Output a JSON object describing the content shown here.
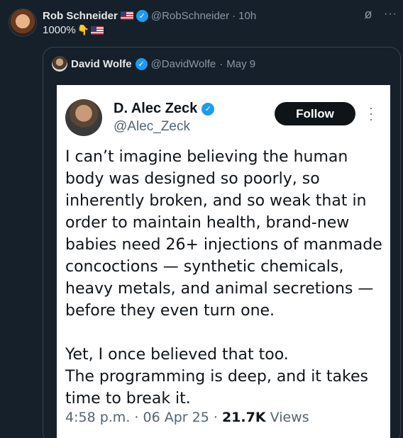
{
  "post": {
    "author_name": "Rob Schneider",
    "handle": "@RobSchneider",
    "time": "10h",
    "text": "1000%",
    "icons": [
      "us-flag-icon",
      "verified-icon",
      "grok-icon",
      "more-icon",
      "pointing-down-icon"
    ]
  },
  "quote": {
    "author_name": "David Wolfe",
    "handle": "@DavidWolfe",
    "date": "May 9"
  },
  "card": {
    "name": "D. Alec Zeck",
    "handle": "@Alec_Zeck",
    "follow_label": "Follow",
    "body_lines_1": [
      "I can’t imagine believing the human",
      "body was designed so poorly, so",
      "inherently broken, and so weak that in",
      "order to maintain health, brand-new",
      "babies need 26+ injections of manmade",
      "concoctions — synthetic chemicals,",
      "heavy metals, and animal secretions —",
      "before they even turn one."
    ],
    "body_lines_2": [
      "Yet, I once believed that too.",
      "The programming is deep, and it takes",
      "time to break it."
    ],
    "time": "4:58 p.m.",
    "date": "06 Apr 25",
    "views_count": "21.7K",
    "views_label": "Views"
  },
  "colors": {
    "background": "#15202b",
    "verified": "#1d9bf0",
    "muted": "#8b98a5"
  }
}
